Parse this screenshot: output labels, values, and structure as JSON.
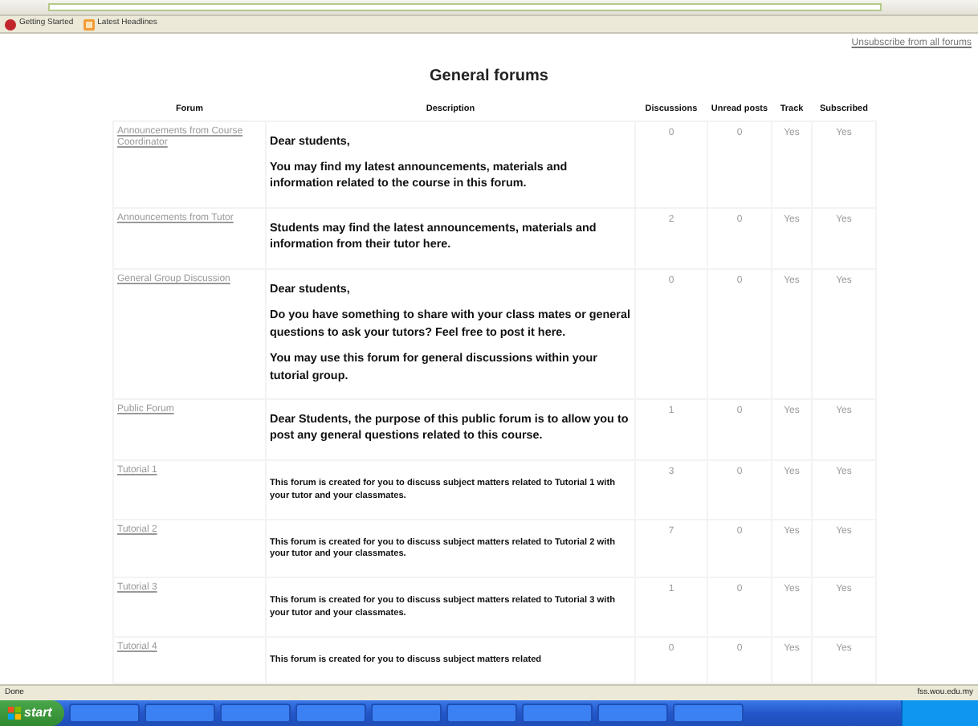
{
  "bookmarks": [
    {
      "label": "Getting Started",
      "kind": "page"
    },
    {
      "label": "Latest Headlines",
      "kind": "feed"
    }
  ],
  "unsubscribe_link": "Unsubscribe from all forums",
  "section_title": "General forums",
  "table": {
    "columns": [
      "Forum",
      "Description",
      "Discussions",
      "Unread posts",
      "Track",
      "Subscribed"
    ],
    "rows": [
      {
        "forum": "Announcements from Course Coordinator",
        "kind": "normal",
        "description": [
          "Dear students,",
          "You may find my latest announcements, materials and information related to the course in this forum."
        ],
        "discussions": "0",
        "unread": "0",
        "track": "Yes",
        "subscribed": "Yes"
      },
      {
        "forum": "Announcements from Tutor",
        "kind": "normal",
        "description": [
          "Students may find the latest announcements, materials and information from their tutor here."
        ],
        "discussions": "2",
        "unread": "0",
        "track": "Yes",
        "subscribed": "Yes"
      },
      {
        "forum": "General Group Discussion",
        "kind": "normal",
        "description": [
          "Dear students,",
          "Do you have something to share with your class mates or general questions to ask your tutors? Feel free to post it here.",
          "You may use this forum for general discussions within your tutorial group."
        ],
        "discussions": "0",
        "unread": "0",
        "track": "Yes",
        "subscribed": "Yes"
      },
      {
        "forum": "Public Forum",
        "kind": "normal",
        "description": [
          "Dear Students, the purpose of this public forum is to allow you to post any general questions related to this course."
        ],
        "discussions": "1",
        "unread": "0",
        "track": "Yes",
        "subscribed": "Yes"
      },
      {
        "forum": "Tutorial 1",
        "kind": "note",
        "description": [
          "This forum is created for you to discuss subject matters related to Tutorial 1 with your tutor and your classmates."
        ],
        "discussions": "3",
        "unread": "0",
        "track": "Yes",
        "subscribed": "Yes"
      },
      {
        "forum": "Tutorial 2",
        "kind": "note",
        "description": [
          "This forum is created for you to discuss subject matters related to Tutorial 2 with your tutor and your classmates."
        ],
        "discussions": "7",
        "unread": "0",
        "track": "Yes",
        "subscribed": "Yes"
      },
      {
        "forum": "Tutorial 3",
        "kind": "note",
        "description": [
          "This forum is created for you to discuss subject matters related to Tutorial 3 with your tutor and your classmates."
        ],
        "discussions": "1",
        "unread": "0",
        "track": "Yes",
        "subscribed": "Yes"
      },
      {
        "forum": "Tutorial 4",
        "kind": "note",
        "description": [
          "This forum is created for you to discuss subject matters related"
        ],
        "discussions": "0",
        "unread": "0",
        "track": "Yes",
        "subscribed": "Yes"
      }
    ]
  },
  "status_bar": {
    "left": "Done",
    "right": "fss.wou.edu.my"
  },
  "taskbar": {
    "start": "start"
  }
}
